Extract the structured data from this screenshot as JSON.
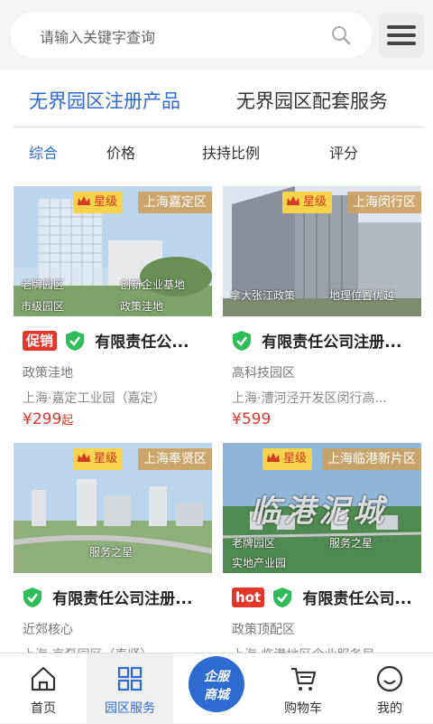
{
  "search": {
    "placeholder": "请输入关键字查询"
  },
  "main_tabs": [
    {
      "label": "无界园区注册产品"
    },
    {
      "label": "无界园区配套服务"
    }
  ],
  "sub_tabs": [
    {
      "label": "综合"
    },
    {
      "label": "价格"
    },
    {
      "label": "扶持比例"
    },
    {
      "label": "评分"
    }
  ],
  "cards": [
    {
      "star": "星级",
      "district": "上海嘉定区",
      "tags": [
        "老牌园区",
        "创新企业基地",
        "市级园区",
        "政策洼地"
      ],
      "promo": "促销",
      "title": "有限责任公...",
      "category": "政策洼地",
      "location": "上海·嘉定工业园（嘉定）",
      "price": "¥299",
      "price_suffix": "起"
    },
    {
      "star": "星级",
      "district": "上海闵行区",
      "tags": [
        "拿大张江政策",
        "地理位置优越"
      ],
      "promo": "",
      "title": "有限责任公司注册...",
      "category": "高科技园区",
      "location": "上海·漕河泾开发区闵行高...",
      "price": "¥599",
      "price_suffix": ""
    },
    {
      "star": "星级",
      "district": "上海奉贤区",
      "tags": [
        "服务之星"
      ],
      "promo": "",
      "title": "有限责任公司注册...",
      "category": "近郊核心",
      "location": "上海·京磊园区（奉贤）",
      "price": "",
      "price_suffix": ""
    },
    {
      "star": "星级",
      "district": "上海临港新片区",
      "tags": [
        "老牌园区",
        "服务之星",
        "实地产业园"
      ],
      "overlay": "临港泥城",
      "promo": "hot",
      "title": "有限责任公司...",
      "category": "政策顶配区",
      "location": "上海·临港地区企业服务局...",
      "price": "",
      "price_suffix": ""
    }
  ],
  "bottom_nav": [
    {
      "label": "首页"
    },
    {
      "label": "园区服务"
    },
    {
      "label_line1": "企服",
      "label_line2": "商城"
    },
    {
      "label": "购物车"
    },
    {
      "label": "我的"
    }
  ],
  "colors": {
    "accent": "#2e6bd0",
    "promo": "#e3372c",
    "badge": "#f7d24b",
    "district_bg": "#cda05f",
    "verified": "#2ebd59"
  }
}
